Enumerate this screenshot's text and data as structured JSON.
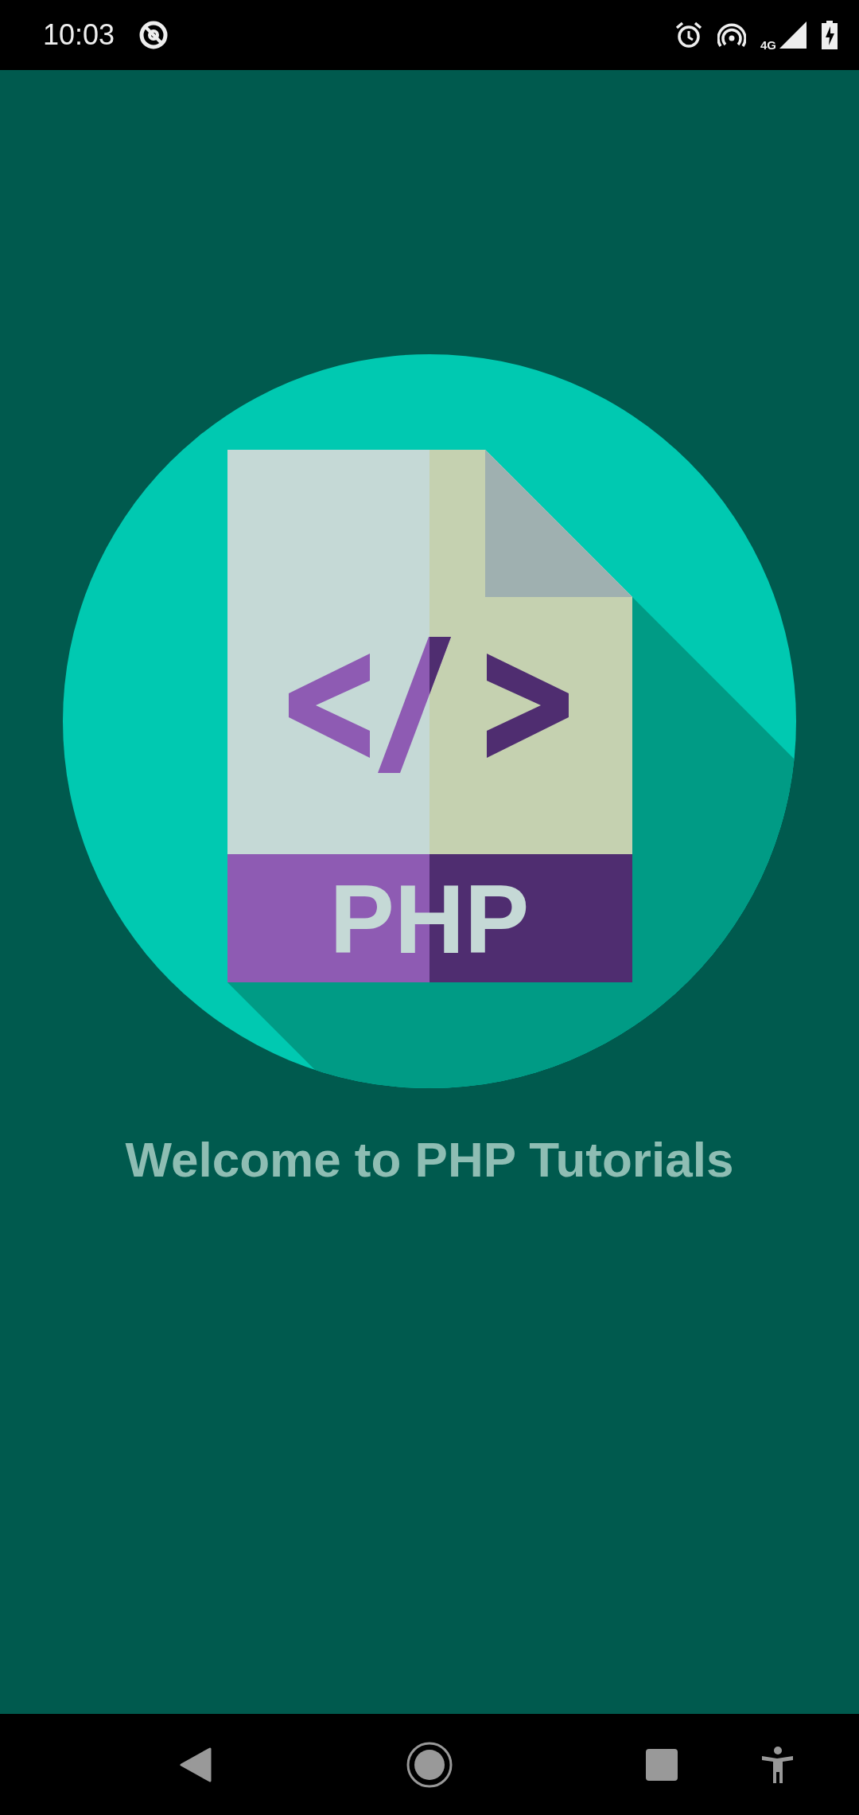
{
  "status_bar": {
    "time": "10:03",
    "network": "4G"
  },
  "logo": {
    "label": "PHP"
  },
  "title": "Welcome to PHP Tutorials"
}
